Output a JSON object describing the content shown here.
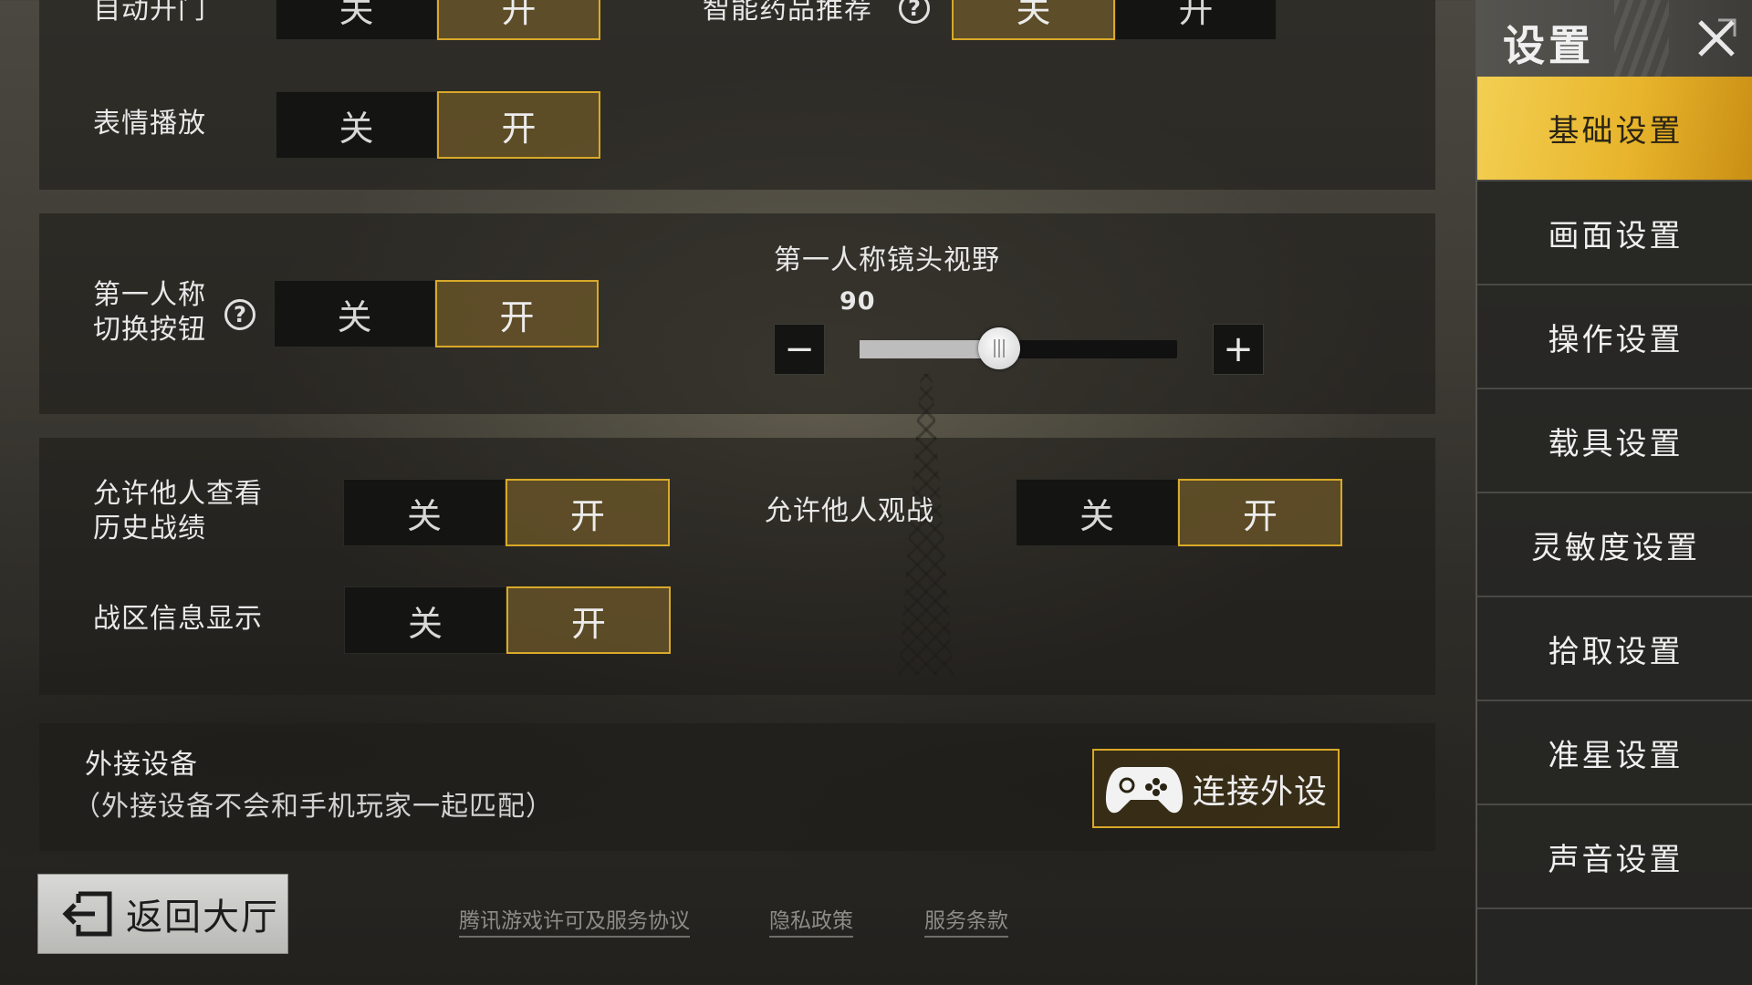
{
  "rows": {
    "auto_door": {
      "label": "自动开门",
      "off": "关",
      "on": "开"
    },
    "smart_meds": {
      "label": "智能药品推荐",
      "off": "关",
      "on": "开"
    },
    "emote": {
      "label": "表情播放",
      "off": "关",
      "on": "开"
    },
    "fpp_button": {
      "label_line1": "第一人称",
      "label_line2": "切换按钮",
      "off": "关",
      "on": "开"
    },
    "fpp_fov": {
      "label": "第一人称镜头视野",
      "value": "90",
      "level": 0.44,
      "minus": "−",
      "plus": "+"
    },
    "history": {
      "label_line1": "允许他人查看",
      "label_line2": "历史战绩",
      "off": "关",
      "on": "开"
    },
    "spectate": {
      "label": "允许他人观战",
      "off": "关",
      "on": "开"
    },
    "region": {
      "label": "战区信息显示",
      "off": "关",
      "on": "开"
    }
  },
  "help_glyph": "?",
  "external": {
    "title": "外接设备",
    "subtitle": "（外接设备不会和手机玩家一起匹配）",
    "button": "连接外设",
    "button_icon": "gamepad-icon"
  },
  "back": {
    "label": "返回大厅",
    "icon": "exit-icon"
  },
  "footer": {
    "links": [
      "腾讯游戏许可及服务协议",
      "隐私政策",
      "服务条款"
    ]
  },
  "sidebar": {
    "title": "设置",
    "items": [
      "基础设置",
      "画面设置",
      "操作设置",
      "载具设置",
      "灵敏度设置",
      "拾取设置",
      "准星设置",
      "声音设置"
    ]
  },
  "colors": {
    "accent": "#d9a928",
    "active_tab": "#e8b52c"
  }
}
